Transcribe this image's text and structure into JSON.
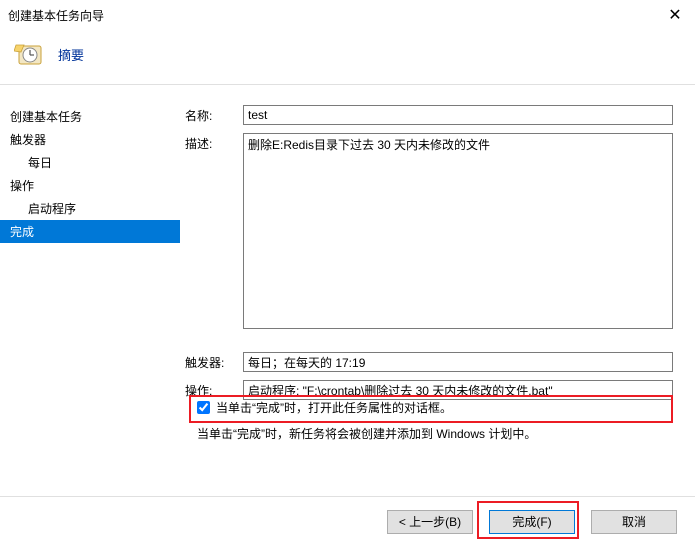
{
  "window": {
    "title": "创建基本任务向导",
    "close_glyph": "✕"
  },
  "header": {
    "title": "摘要"
  },
  "sidebar": {
    "items": [
      {
        "label": "创建基本任务",
        "indent": false
      },
      {
        "label": "触发器",
        "indent": false
      },
      {
        "label": "每日",
        "indent": true
      },
      {
        "label": "操作",
        "indent": false
      },
      {
        "label": "启动程序",
        "indent": true
      },
      {
        "label": "完成",
        "indent": false,
        "selected": true
      }
    ]
  },
  "form": {
    "name_label": "名称:",
    "name_value": "test",
    "desc_label": "描述:",
    "desc_value": "删除E:Redis目录下过去 30 天内未修改的文件",
    "trigger_label": "触发器:",
    "trigger_value": "每日；在每天的 17:19",
    "action_label": "操作:",
    "action_value": "启动程序; \"F:\\crontab\\删除过去 30 天内未修改的文件.bat\"",
    "open_props_label": "当单击“完成”时，打开此任务属性的对话框。",
    "open_props_checked": true,
    "note": "当单击“完成”时，新任务将会被创建并添加到 Windows 计划中。"
  },
  "buttons": {
    "back": "< 上一步(B)",
    "finish": "完成(F)",
    "cancel": "取消"
  }
}
